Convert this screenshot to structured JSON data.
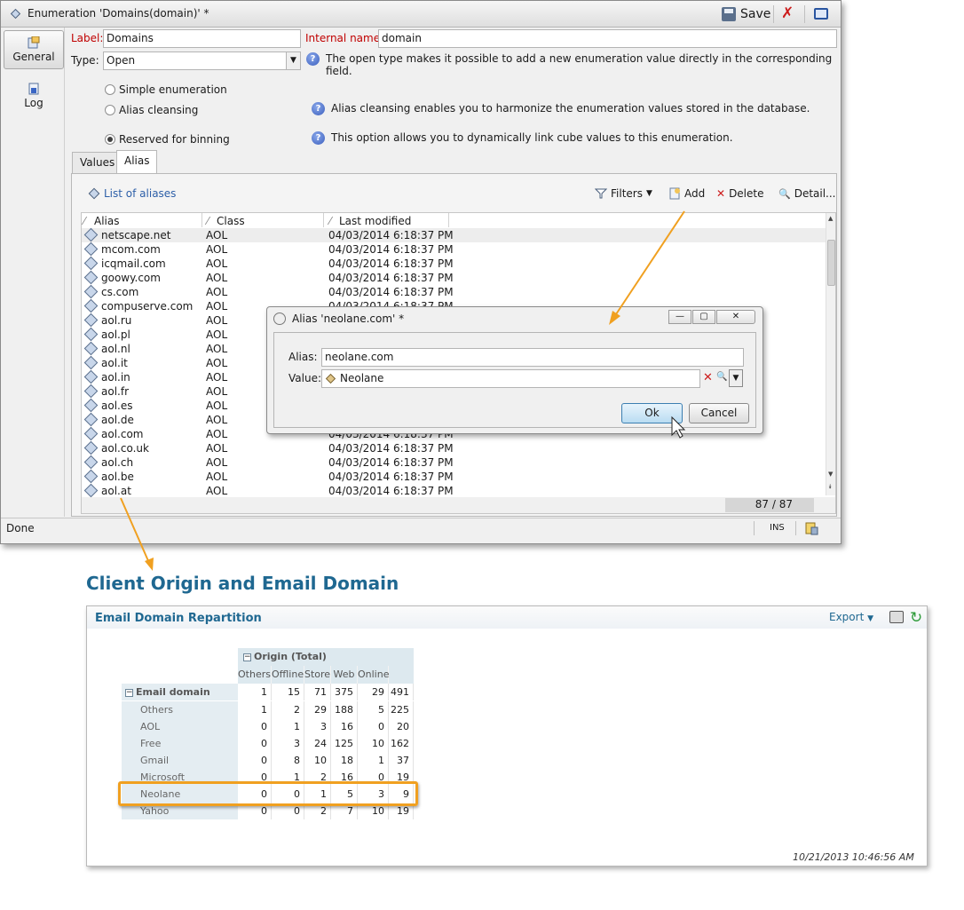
{
  "window": {
    "title": "Enumeration 'Domains(domain)' *",
    "save_label": "Save"
  },
  "nav": {
    "general": "General",
    "log": "Log"
  },
  "form": {
    "label_caption": "Label:",
    "label_value": "Domains",
    "internal_caption": "Internal name:",
    "internal_value": "domain",
    "type_caption": "Type:",
    "type_value": "Open",
    "type_help": "The open type makes it possible to add a new enumeration value directly in the corresponding field.",
    "radio_simple": "Simple enumeration",
    "radio_alias": "Alias cleansing",
    "radio_binning": "Reserved for binning",
    "alias_help": "Alias cleansing enables you to harmonize the enumeration values stored in the database.",
    "binning_help": "This option allows you to dynamically link cube values to this enumeration."
  },
  "tabs": {
    "values": "Values",
    "alias": "Alias"
  },
  "list": {
    "title": "List of aliases",
    "filters": "Filters",
    "add": "Add",
    "delete": "Delete",
    "detail": "Detail...",
    "col_alias": "Alias",
    "col_class": "Class",
    "col_modified": "Last modified",
    "count": "87 / 87",
    "rows": [
      {
        "alias": "netscape.net",
        "class": "AOL",
        "modified": "04/03/2014 6:18:37 PM"
      },
      {
        "alias": "mcom.com",
        "class": "AOL",
        "modified": "04/03/2014 6:18:37 PM"
      },
      {
        "alias": "icqmail.com",
        "class": "AOL",
        "modified": "04/03/2014 6:18:37 PM"
      },
      {
        "alias": "goowy.com",
        "class": "AOL",
        "modified": "04/03/2014 6:18:37 PM"
      },
      {
        "alias": "cs.com",
        "class": "AOL",
        "modified": "04/03/2014 6:18:37 PM"
      },
      {
        "alias": "compuserve.com",
        "class": "AOL",
        "modified": "04/03/2014 6:18:37 PM"
      },
      {
        "alias": "aol.ru",
        "class": "AOL",
        "modified": ""
      },
      {
        "alias": "aol.pl",
        "class": "AOL",
        "modified": ""
      },
      {
        "alias": "aol.nl",
        "class": "AOL",
        "modified": ""
      },
      {
        "alias": "aol.it",
        "class": "AOL",
        "modified": ""
      },
      {
        "alias": "aol.in",
        "class": "AOL",
        "modified": ""
      },
      {
        "alias": "aol.fr",
        "class": "AOL",
        "modified": ""
      },
      {
        "alias": "aol.es",
        "class": "AOL",
        "modified": ""
      },
      {
        "alias": "aol.de",
        "class": "AOL",
        "modified": ""
      },
      {
        "alias": "aol.com",
        "class": "AOL",
        "modified": "04/03/2014 6:18:37 PM"
      },
      {
        "alias": "aol.co.uk",
        "class": "AOL",
        "modified": "04/03/2014 6:18:37 PM"
      },
      {
        "alias": "aol.ch",
        "class": "AOL",
        "modified": "04/03/2014 6:18:37 PM"
      },
      {
        "alias": "aol.be",
        "class": "AOL",
        "modified": "04/03/2014 6:18:37 PM"
      },
      {
        "alias": "aol.at",
        "class": "AOL",
        "modified": "04/03/2014 6:18:37 PM"
      }
    ]
  },
  "status": {
    "done": "Done",
    "ins": "INS"
  },
  "dialog": {
    "title": "Alias 'neolane.com' *",
    "alias_caption": "Alias:",
    "alias_value": "neolane.com",
    "value_caption": "Value:",
    "value_value": "Neolane",
    "ok": "Ok",
    "cancel": "Cancel"
  },
  "report": {
    "title": "Client Origin and Email Domain",
    "card_title": "Email Domain Repartition",
    "export": "Export",
    "timestamp": "10/21/2013 10:46:56 AM",
    "origin_header": "Origin (Total)",
    "columns": [
      "Others",
      "Offline",
      "Store",
      "Web",
      "Online"
    ],
    "total_row_label": "Email domain (Total)",
    "total_row": [
      "1",
      "15",
      "71",
      "375",
      "29",
      "491"
    ],
    "rows": [
      {
        "label": "Others",
        "values": [
          "1",
          "2",
          "29",
          "188",
          "5",
          "225"
        ]
      },
      {
        "label": "AOL",
        "values": [
          "0",
          "1",
          "3",
          "16",
          "0",
          "20"
        ]
      },
      {
        "label": "Free",
        "values": [
          "0",
          "3",
          "24",
          "125",
          "10",
          "162"
        ]
      },
      {
        "label": "Gmail",
        "values": [
          "0",
          "8",
          "10",
          "18",
          "1",
          "37"
        ]
      },
      {
        "label": "Microsoft",
        "values": [
          "0",
          "1",
          "2",
          "16",
          "0",
          "19"
        ]
      },
      {
        "label": "Neolane",
        "values": [
          "0",
          "0",
          "1",
          "5",
          "3",
          "9"
        ]
      },
      {
        "label": "Yahoo",
        "values": [
          "0",
          "0",
          "2",
          "7",
          "10",
          "19"
        ]
      }
    ]
  },
  "colors": {
    "accent": "#1f6891",
    "highlight": "#f0a020",
    "required": "#c00000"
  }
}
